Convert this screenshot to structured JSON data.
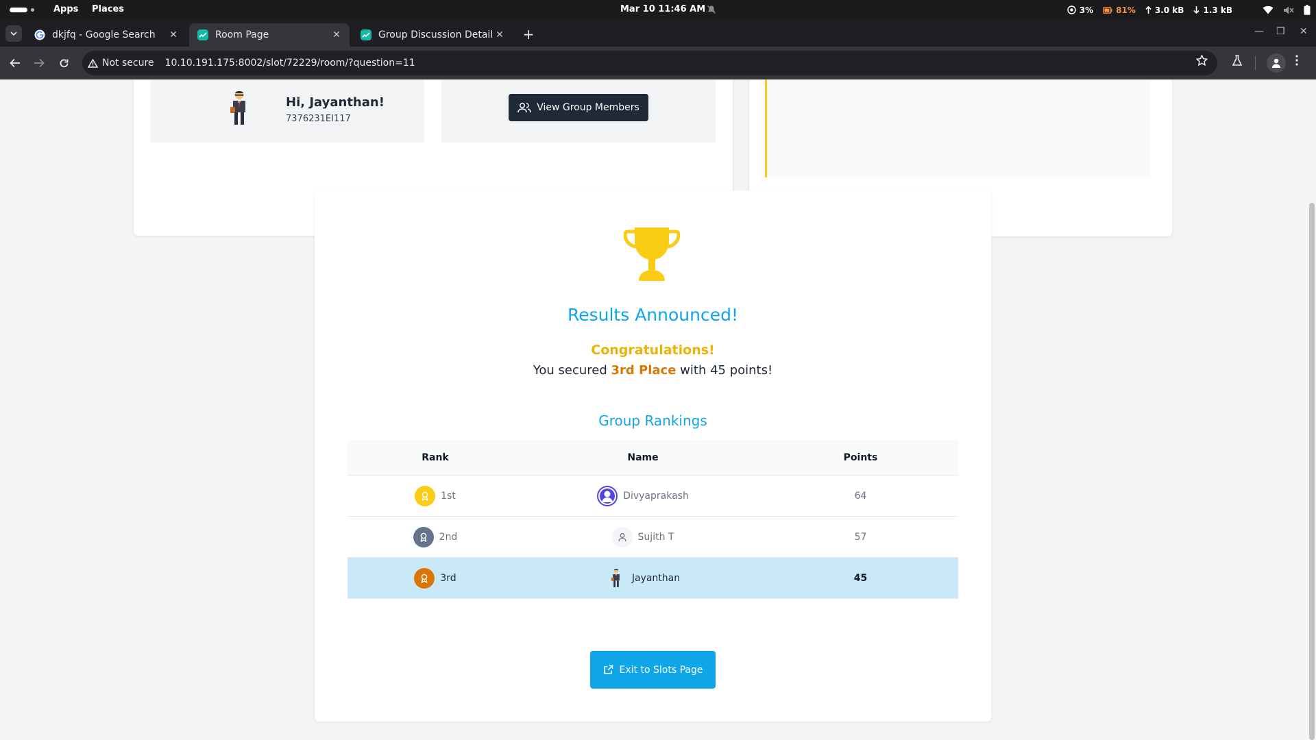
{
  "os": {
    "apps_label": "Apps",
    "places_label": "Places",
    "clock": "Mar 10  11:46 AM",
    "cpu": "3%",
    "battery": "81%",
    "upload": "3.0 kB",
    "download": "1.3 kB"
  },
  "browser": {
    "tabs": [
      {
        "title": "dkjfq - Google Search",
        "favicon_color": "#ffffff"
      },
      {
        "title": "Room Page",
        "favicon_color": "#14b8a6"
      },
      {
        "title": "Group Discussion Details",
        "favicon_color": "#14b8a6"
      }
    ],
    "new_tab_label": "+",
    "security_label": "Not secure",
    "url": "10.10.191.175:8002/slot/72229/room/?question=11"
  },
  "profile": {
    "greeting": "Hi, Jayanthan!",
    "user_id": "7376231EI117",
    "view_members_label": "View Group Members"
  },
  "results": {
    "title": "Results Announced!",
    "congrats": "Congratulations!",
    "secured_prefix": "You secured ",
    "secured_place": "3rd Place",
    "secured_suffix": " with 45 points!",
    "rankings_title": "Group Rankings",
    "columns": {
      "rank": "Rank",
      "name": "Name",
      "points": "Points"
    },
    "rows": [
      {
        "rank": "1st",
        "name": "Divyaprakash",
        "points": "64",
        "medal_color": "#facc15",
        "avatar": "user-circle-icon"
      },
      {
        "rank": "2nd",
        "name": "Sujith T",
        "points": "57",
        "medal_color": "#64748b",
        "avatar": "user-icon"
      },
      {
        "rank": "3rd",
        "name": "Jayanthan",
        "points": "45",
        "medal_color": "#d97706",
        "avatar": "character-avatar"
      }
    ],
    "exit_label": "Exit to Slots Page"
  },
  "colors": {
    "accent": "#0ea5e9",
    "gold": "#facc15",
    "highlight_row": "#c9e9f9",
    "dark_button": "#1f2937"
  }
}
